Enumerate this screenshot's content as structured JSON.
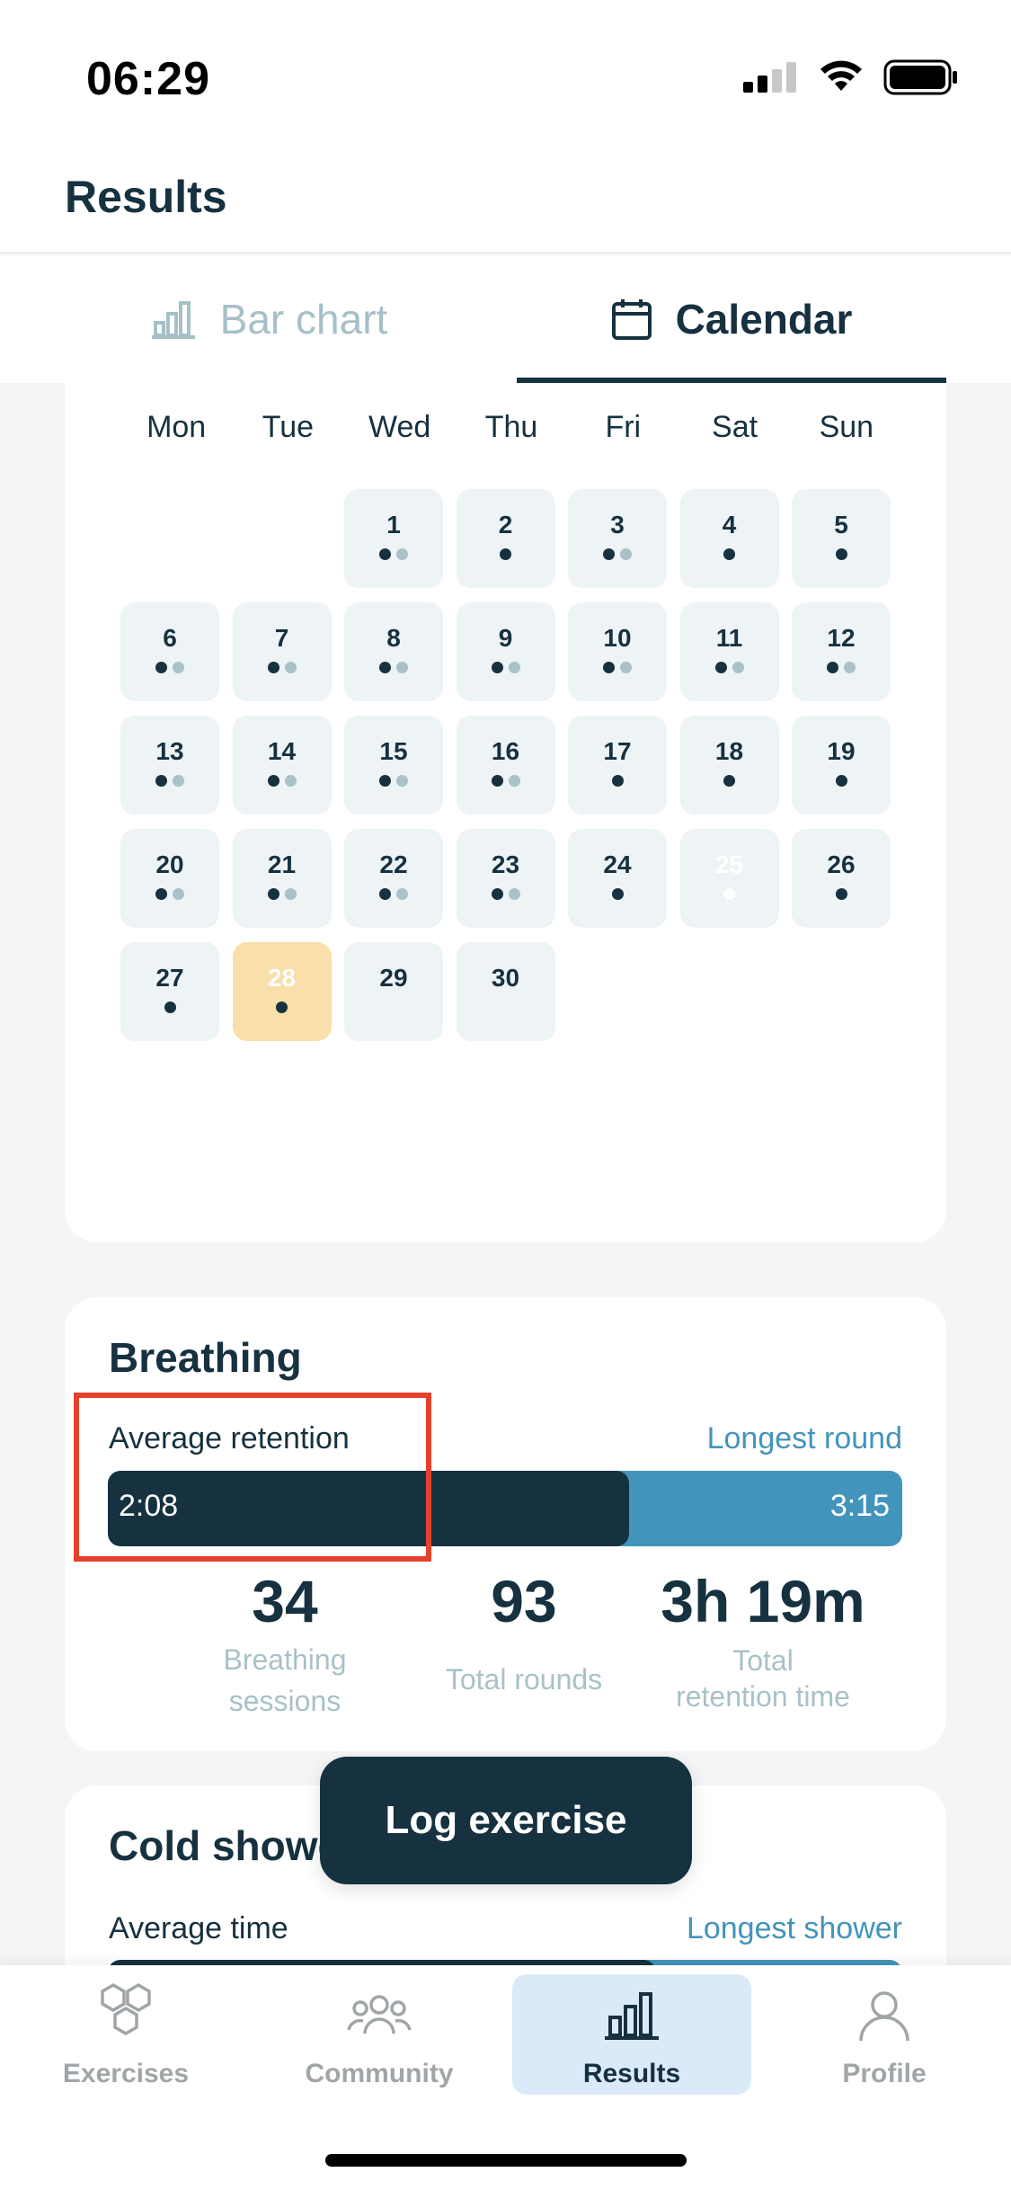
{
  "status": {
    "time": "06:29"
  },
  "header": {
    "title": "Results"
  },
  "tabs": [
    {
      "label": "Bar chart",
      "active": false
    },
    {
      "label": "Calendar",
      "active": true
    }
  ],
  "calendar": {
    "weekdays": [
      "Mon",
      "Tue",
      "Wed",
      "Thu",
      "Fri",
      "Sat",
      "Sun"
    ],
    "leading_blanks": 2,
    "days": [
      {
        "n": "1",
        "dots": [
          "dark",
          "light"
        ]
      },
      {
        "n": "2",
        "dots": [
          "dark"
        ]
      },
      {
        "n": "3",
        "dots": [
          "dark",
          "light"
        ]
      },
      {
        "n": "4",
        "dots": [
          "dark"
        ]
      },
      {
        "n": "5",
        "dots": [
          "dark"
        ]
      },
      {
        "n": "6",
        "dots": [
          "dark",
          "light"
        ]
      },
      {
        "n": "7",
        "dots": [
          "dark",
          "light"
        ]
      },
      {
        "n": "8",
        "dots": [
          "dark",
          "light"
        ]
      },
      {
        "n": "9",
        "dots": [
          "dark",
          "light"
        ]
      },
      {
        "n": "10",
        "dots": [
          "dark",
          "light"
        ]
      },
      {
        "n": "11",
        "dots": [
          "dark",
          "light"
        ]
      },
      {
        "n": "12",
        "dots": [
          "dark",
          "light"
        ]
      },
      {
        "n": "13",
        "dots": [
          "dark",
          "light"
        ]
      },
      {
        "n": "14",
        "dots": [
          "dark",
          "light"
        ]
      },
      {
        "n": "15",
        "dots": [
          "dark",
          "light"
        ]
      },
      {
        "n": "16",
        "dots": [
          "dark",
          "light"
        ]
      },
      {
        "n": "17",
        "dots": [
          "dark"
        ]
      },
      {
        "n": "18",
        "dots": [
          "dark"
        ]
      },
      {
        "n": "19",
        "dots": [
          "dark"
        ]
      },
      {
        "n": "20",
        "dots": [
          "dark",
          "light"
        ]
      },
      {
        "n": "21",
        "dots": [
          "dark",
          "light"
        ]
      },
      {
        "n": "22",
        "dots": [
          "dark",
          "light"
        ]
      },
      {
        "n": "23",
        "dots": [
          "dark",
          "light"
        ]
      },
      {
        "n": "24",
        "dots": [
          "dark"
        ]
      },
      {
        "n": "25",
        "dots": [
          "white"
        ],
        "faded": true
      },
      {
        "n": "26",
        "dots": [
          "dark"
        ]
      },
      {
        "n": "27",
        "dots": [
          "dark"
        ]
      },
      {
        "n": "28",
        "dots": [
          "dark"
        ],
        "today": true
      },
      {
        "n": "29",
        "dots": []
      },
      {
        "n": "30",
        "dots": []
      }
    ]
  },
  "breathing": {
    "title": "Breathing",
    "average_label": "Average retention",
    "longest_label": "Longest round",
    "average_value": "2:08",
    "longest_value": "3:15",
    "average_fraction": 0.656,
    "stats": [
      {
        "value": "34",
        "label_lines": [
          "Breathing",
          "sessions"
        ]
      },
      {
        "value": "93",
        "label_lines": [
          "Total rounds"
        ]
      },
      {
        "value": "3h 19m",
        "label_lines": [
          "Total",
          "retention time"
        ]
      }
    ]
  },
  "cold_shower": {
    "title": "Cold showe",
    "average_label": "Average time",
    "longest_label": "Longest shower"
  },
  "log_button": {
    "label": "Log exercise"
  },
  "nav": [
    {
      "id": "exercises",
      "label": "Exercises",
      "active": false
    },
    {
      "id": "community",
      "label": "Community",
      "active": false
    },
    {
      "id": "results",
      "label": "Results",
      "active": true
    },
    {
      "id": "profile",
      "label": "Profile",
      "active": false
    }
  ],
  "colors": {
    "primary": "#16313f",
    "accent": "#4394bb",
    "today": "#f9dfaa",
    "highlight": "#e5402b"
  }
}
